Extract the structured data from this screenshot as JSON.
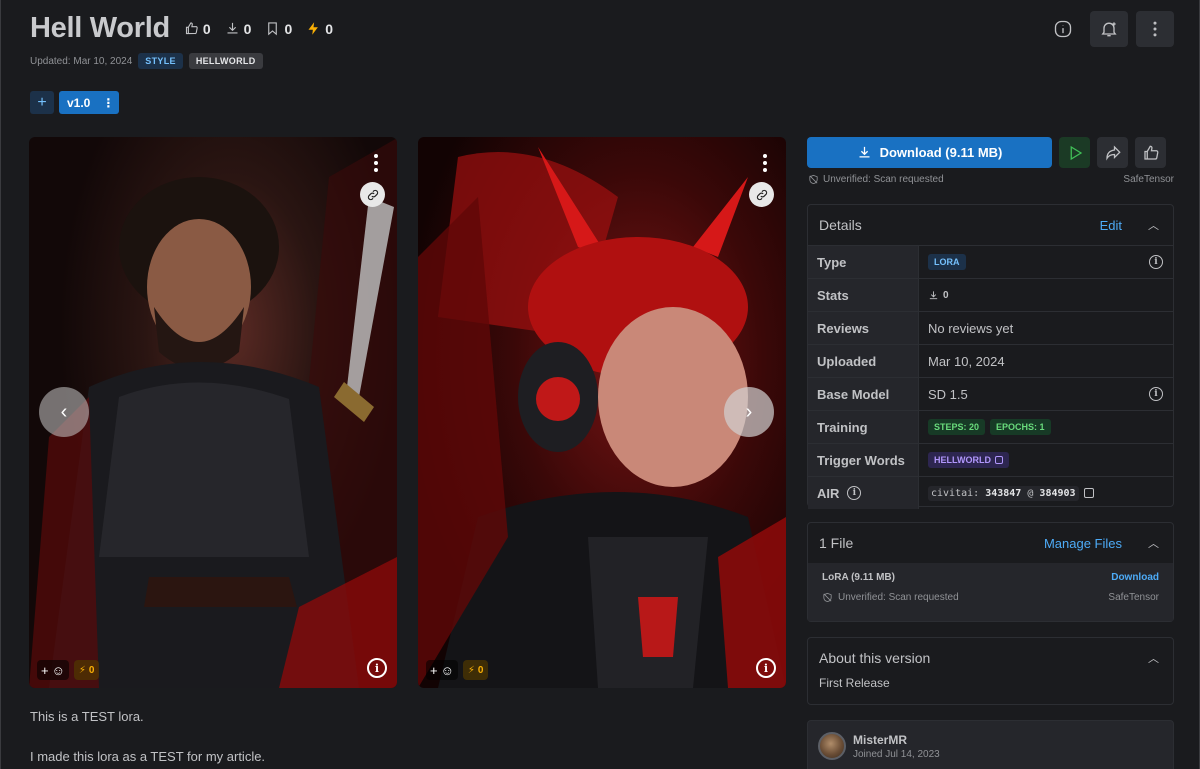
{
  "header": {
    "title": "Hell World",
    "likes": "0",
    "downloads": "0",
    "bookmarks": "0",
    "buzz": "0",
    "updated": "Updated: Mar 10, 2024",
    "tags": [
      "STYLE",
      "HELLWORLD"
    ]
  },
  "version": {
    "label": "v1.0"
  },
  "gallery": {
    "reactions": "0",
    "buzz": "0"
  },
  "description": {
    "line1": "This is a TEST lora.",
    "line2": "I made this lora as a TEST for my article."
  },
  "download": {
    "label": "Download (9.11 MB)",
    "scan": "Unverified: Scan requested",
    "format": "SafeTensor"
  },
  "details": {
    "title": "Details",
    "edit": "Edit",
    "rows": {
      "type_k": "Type",
      "type_v": "LORA",
      "stats_k": "Stats",
      "stats_v": "0",
      "reviews_k": "Reviews",
      "reviews_v": "No reviews yet",
      "uploaded_k": "Uploaded",
      "uploaded_v": "Mar 10, 2024",
      "base_k": "Base Model",
      "base_v": "SD 1.5",
      "training_k": "Training",
      "steps": "STEPS: 20",
      "epochs": "EPOCHS: 1",
      "trigger_k": "Trigger Words",
      "trigger_v": "HELLWORLD",
      "air_k": "AIR",
      "air_prefix": "civitai:",
      "air_model": "343847",
      "air_at": "@",
      "air_version": "384903"
    }
  },
  "files": {
    "title": "1 File",
    "manage": "Manage Files",
    "name": "LoRA (9.11 MB)",
    "download": "Download",
    "scan": "Unverified: Scan requested",
    "format": "SafeTensor"
  },
  "about": {
    "title": "About this version",
    "text": "First Release"
  },
  "creator": {
    "name": "MisterMR",
    "joined": "Joined Jul 14, 2023"
  },
  "colors": {
    "accent": "#1971c2",
    "background": "#1a1b1e",
    "buzz": "#fab005"
  }
}
